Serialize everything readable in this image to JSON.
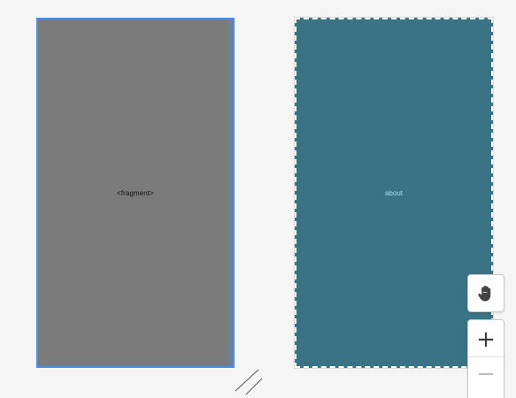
{
  "graph": {
    "destinations": [
      {
        "label": "<fragment>",
        "selected": true
      },
      {
        "label": "about",
        "selected": false
      }
    ]
  },
  "toolbar": {
    "pan_icon": "hand-pan-icon",
    "zoom_in_label": "+",
    "zoom_out_label": "−"
  },
  "colors": {
    "canvas": "#f5f5f5",
    "fragment_fill": "#7b7b7b",
    "selection_blue": "#4a8fe6",
    "about_fill": "#3a7286",
    "about_label": "#9fe0ee"
  }
}
